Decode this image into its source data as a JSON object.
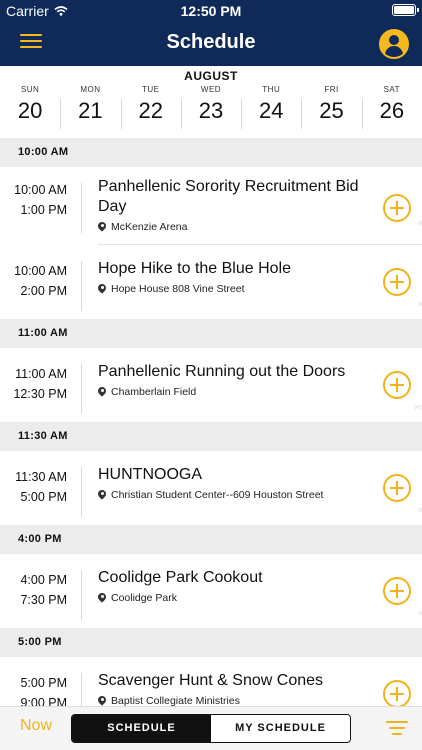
{
  "status_bar": {
    "carrier": "Carrier",
    "time": "12:50 PM"
  },
  "nav": {
    "title": "Schedule"
  },
  "week": {
    "month": "AUGUST",
    "days": [
      {
        "name": "SUN",
        "num": "20"
      },
      {
        "name": "MON",
        "num": "21"
      },
      {
        "name": "TUE",
        "num": "22"
      },
      {
        "name": "WED",
        "num": "23"
      },
      {
        "name": "THU",
        "num": "24"
      },
      {
        "name": "FRI",
        "num": "25"
      },
      {
        "name": "SAT",
        "num": "26"
      }
    ]
  },
  "sections": [
    {
      "header": "10:00 AM",
      "events": [
        {
          "start": "10:00 AM",
          "end": "1:00 PM",
          "dots": "○",
          "name": "Panhellenic Sorority Recruitment Bid Day",
          "location": "McKenzie Arena"
        },
        {
          "start": "10:00 AM",
          "end": "2:00 PM",
          "dots": "○",
          "name": "Hope Hike to the Blue Hole",
          "location": "Hope House 808 Vine Street"
        }
      ]
    },
    {
      "header": "11:00 AM",
      "events": [
        {
          "start": "11:00 AM",
          "end": "12:30 PM",
          "dots": "○○",
          "name": "Panhellenic Running out the Doors",
          "location": "Chamberlain Field"
        }
      ]
    },
    {
      "header": "11:30 AM",
      "events": [
        {
          "start": "11:30 AM",
          "end": "5:00 PM",
          "dots": "○",
          "name": "HUNTNOOGA",
          "location": "Christian Student Center--609 Houston Street"
        }
      ]
    },
    {
      "header": "4:00 PM",
      "events": [
        {
          "start": "4:00 PM",
          "end": "7:30 PM",
          "dots": "○",
          "name": "Coolidge Park Cookout",
          "location": "Coolidge Park"
        }
      ]
    },
    {
      "header": "5:00 PM",
      "events": [
        {
          "start": "5:00 PM",
          "end": "9:00 PM",
          "dots": "",
          "name": "Scavenger Hunt & Snow Cones",
          "location": "Baptist Collegiate Ministries"
        }
      ]
    }
  ],
  "bottom": {
    "now_label": "Now",
    "tabs": [
      {
        "label": "SCHEDULE",
        "active": true
      },
      {
        "label": "MY SCHEDULE",
        "active": false
      }
    ]
  },
  "colors": {
    "navy": "#0f2a58",
    "accent": "#f2b31a",
    "section_bg": "#ececec"
  }
}
